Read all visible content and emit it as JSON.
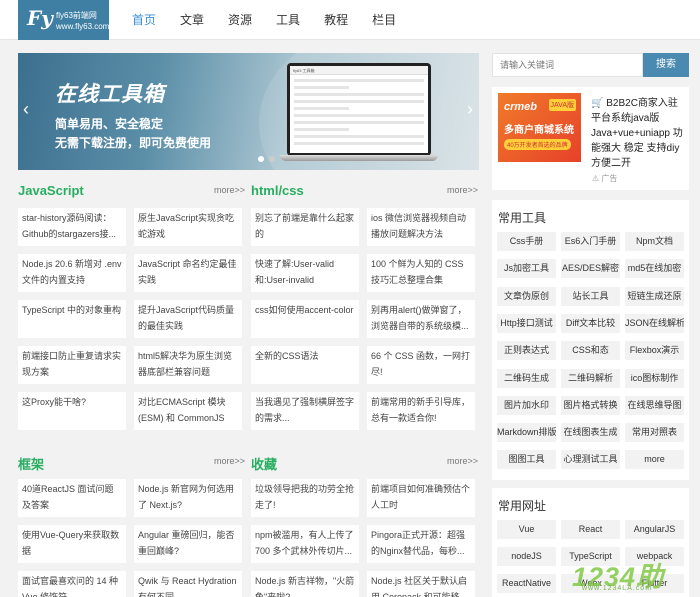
{
  "logo": {
    "mark": "Fy",
    "line1": "fly63前端网",
    "line2": "www.fly63.com"
  },
  "nav": [
    "首页",
    "文章",
    "资源",
    "工具",
    "教程",
    "栏目"
  ],
  "banner": {
    "title": "在线工具箱",
    "sub1": "简单易用、安全稳定",
    "sub2": "无需下载注册，即可免费使用",
    "prev": "‹",
    "next": "›",
    "screen_title": "fly63 工具箱"
  },
  "more_label": "more>>",
  "sections": {
    "javascript": {
      "title": "JavaScript",
      "cards": [
        "star-history源码阅读：Github的stargazers接...",
        "原生JavaScript实现贪吃蛇游戏",
        "Node.js 20.6 新增对 .env 文件的内置支持",
        "JavaScript 命名约定最佳实践",
        "TypeScript 中的对象重构",
        "提升JavaScript代码质量的最佳实践",
        "前端接口防止重复请求实现方案",
        "html5解决华为原生浏览器底部栏兼容问题",
        "这Proxy能干啥?",
        "对比ECMAScript 模块 (ESM) 和 CommonJS"
      ]
    },
    "htmlcss": {
      "title": "html/css",
      "cards": [
        "别忘了前端是靠什么起家的",
        "ios 微信浏览器视频自动播放问题解决方法",
        "快速了解:User-valid和:User-invalid",
        "100 个鲜为人知的 CSS 技巧汇总整理合集",
        "css如何使用accent-color",
        "别再用alert()做弹窗了，浏览器自带的系统级模...",
        "全新的CSS语法",
        "66 个 CSS 函数，一网打尽!",
        "当我遇见了强制横屏签字的需求...",
        "前端常用的新手引导库，总有一款适合你!"
      ]
    },
    "frameworks": {
      "title": "框架",
      "cards": [
        "40道ReactJS 面试问题及答案",
        "Node.js 新官网为何选用了 Next.js?",
        "使用Vue-Query来获取数据",
        "Angular 重磅回归，能否重回巅峰?",
        "面试官最喜欢问的 14 种 Vue 修饰符",
        "Qwik 与 React Hydration 有何不同"
      ]
    },
    "favorites": {
      "title": "收藏",
      "cards": [
        "垃圾领导把我的功劳全抢走了!",
        "前端项目如何准确预估个人工时",
        "npm被滥用，有人上传了 700 多个武林外传切片...",
        "Pingora正式开源：超强的Nginx替代品，每秒...",
        "Node.js 新吉祥物，\"火箭龟\"来啦?",
        "Node.js 社区关于默认启用 Corepack 和可能移..."
      ]
    }
  },
  "search": {
    "placeholder": "请输入关键词",
    "button": "搜索"
  },
  "ad": {
    "brand": "crmeb",
    "tag": "JAVA版",
    "main": "多商户商城系统",
    "sub": "40万开发者首选的品牌",
    "text": "🛒 B2B2C商家入驻平台系统java版 Java+vue+uniapp 功能强大 稳定 支持diy 方便二开",
    "ad_label": "⚠ 广告"
  },
  "tools": {
    "title": "常用工具",
    "items": [
      "Css手册",
      "Es6入门手册",
      "Npm文档",
      "Js加密工具",
      "AES/DES解密",
      "md5在线加密",
      "文章伪原创",
      "站长工具",
      "短链生成还原",
      "Http接口测试",
      "Diff文本比较",
      "JSON在线解析",
      "正则表达式",
      "CSS和态",
      "Flexbox演示",
      "二维码生成",
      "二维码解析",
      "ico图标制作",
      "图片加水印",
      "图片格式转换",
      "在线思维导图",
      "Markdown排版",
      "在线图表生成",
      "常用对照表",
      "图图工具",
      "心理测试工具",
      "more"
    ]
  },
  "links": {
    "title": "常用网址",
    "items": [
      "Vue",
      "React",
      "AngularJS",
      "nodeJS",
      "TypeScript",
      "webpack",
      "ReactNative",
      "Weex",
      "Flutter"
    ]
  },
  "watermark": {
    "big": "1234助",
    "small": "www.1234LA.com"
  }
}
